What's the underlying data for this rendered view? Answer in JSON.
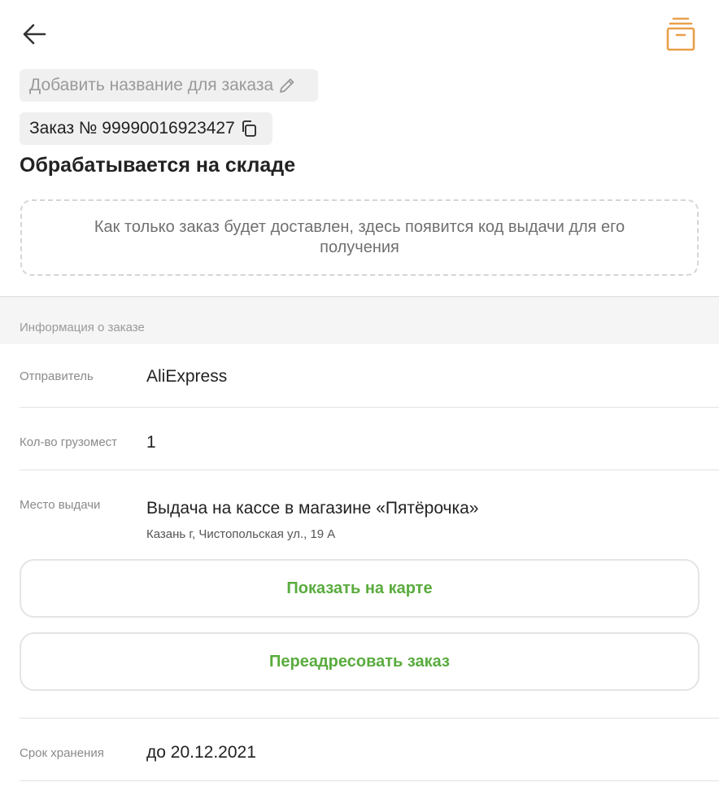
{
  "header": {
    "back_icon": "arrow-left-icon",
    "archive_icon": "archive-box-icon",
    "accent_color": "#e9a04a"
  },
  "order": {
    "name_placeholder": "Добавить название для заказа",
    "number_label": "Заказ № 99990016923427",
    "status": "Обрабатывается на складе",
    "code_notice": "Как только заказ будет доставлен, здесь появится код выдачи для его получения"
  },
  "info": {
    "section_title": "Информация о заказе",
    "sender_label": "Отправитель",
    "sender_value": "AliExpress",
    "parcels_label": "Кол-во грузомест",
    "parcels_value": "1",
    "pickup_label": "Место выдачи",
    "pickup_value": "Выдача на кассе в магазине «Пятёрочка»",
    "pickup_address": "Казань г, Чистопольская ул., 19 А",
    "storage_label": "Срок хранения",
    "storage_value": "до 20.12.2021"
  },
  "buttons": {
    "show_on_map": "Показать на карте",
    "redirect_order": "Переадресовать заказ",
    "button_text_color": "#5aac3e"
  }
}
